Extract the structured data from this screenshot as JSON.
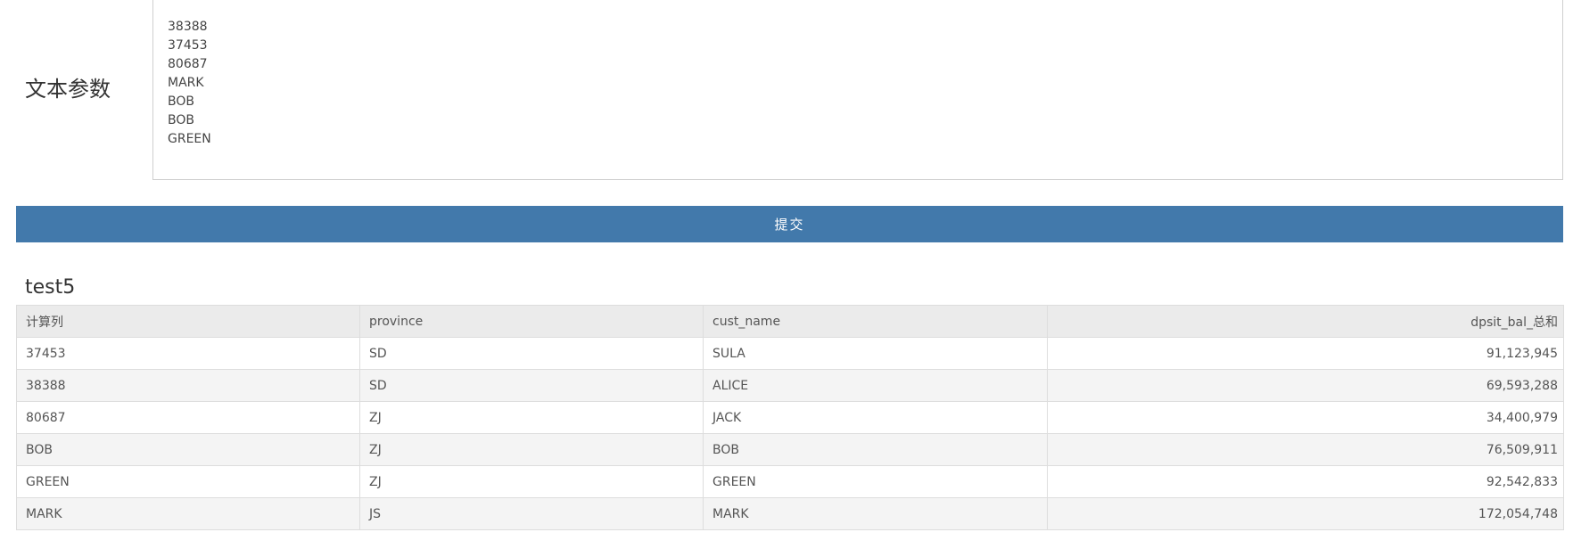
{
  "params": {
    "label": "文本参数",
    "text_value": "38388\n37453\n80687\nMARK\nBOB\nBOB\nGREEN"
  },
  "submit": {
    "label": "提交",
    "color": "#4279ab"
  },
  "table": {
    "title": "test5",
    "headers": [
      "计算列",
      "province",
      "cust_name",
      "dpsit_bal_总和"
    ],
    "rows": [
      [
        "37453",
        "SD",
        "SULA",
        "91,123,945"
      ],
      [
        "38388",
        "SD",
        "ALICE",
        "69,593,288"
      ],
      [
        "80687",
        "ZJ",
        "JACK",
        "34,400,979"
      ],
      [
        "BOB",
        "ZJ",
        "BOB",
        "76,509,911"
      ],
      [
        "GREEN",
        "ZJ",
        "GREEN",
        "92,542,833"
      ],
      [
        "MARK",
        "JS",
        "MARK",
        "172,054,748"
      ]
    ]
  }
}
